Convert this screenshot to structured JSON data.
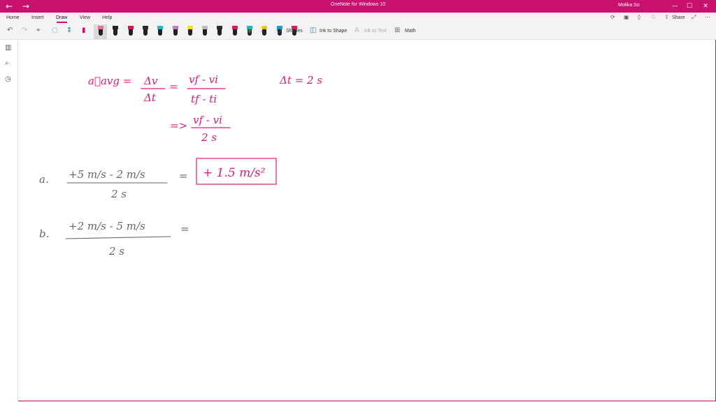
{
  "window": {
    "title": "OneNote for Windows 10",
    "user": "Molika So",
    "back_glyph": "←",
    "forward_glyph": "→",
    "minimize_glyph": "—",
    "maximize_glyph": "☐",
    "close_glyph": "✕"
  },
  "menu": {
    "items": [
      "Home",
      "Insert",
      "Draw",
      "View",
      "Help"
    ],
    "active": "Draw"
  },
  "header_actions": {
    "share": "Share"
  },
  "toolbar": {
    "shapes": "Shapes",
    "ink_to_shape": "Ink to Shape",
    "ink_to_text": "Ink to Text",
    "math": "Math"
  },
  "pens": [
    {
      "tip": "#e8709a"
    },
    {
      "tip": "#222222"
    },
    {
      "tip": "#e0115f"
    },
    {
      "tip": "#2c2c2c"
    },
    {
      "tip": "#21b5d8"
    },
    {
      "tip": "#c07acb"
    },
    {
      "tip": "#f0e016"
    },
    {
      "tip": "#bbbbbb"
    },
    {
      "tip": "#2c2c2c"
    },
    {
      "tip": "#e01763"
    },
    {
      "tip": "#1bb3d7"
    },
    {
      "tip": "#f2d415"
    },
    {
      "tip": "#1b9fd7"
    },
    {
      "tip": "#e01763"
    }
  ],
  "ink_color": "#e0187a",
  "pencil_color": "#666666",
  "note": {
    "def_lhs": "a⃗avg =",
    "def_num1": "Δv",
    "def_den1": "Δt",
    "def_eq": "=",
    "def_num2": "vf - vi",
    "def_den2": "tf - ti",
    "dt_given": "Δt = 2 s",
    "implies": "=>",
    "def_num3": "vf - vi",
    "def_den3": "2 s",
    "a_label": "a.",
    "a_num": "+5 m/s - 2 m/s",
    "a_den": "2 s",
    "a_eq": "=",
    "a_result": "+ 1.5 m/s²",
    "b_label": "b.",
    "b_num": "+2 m/s - 5 m/s",
    "b_den": "2 s",
    "b_eq": "="
  }
}
